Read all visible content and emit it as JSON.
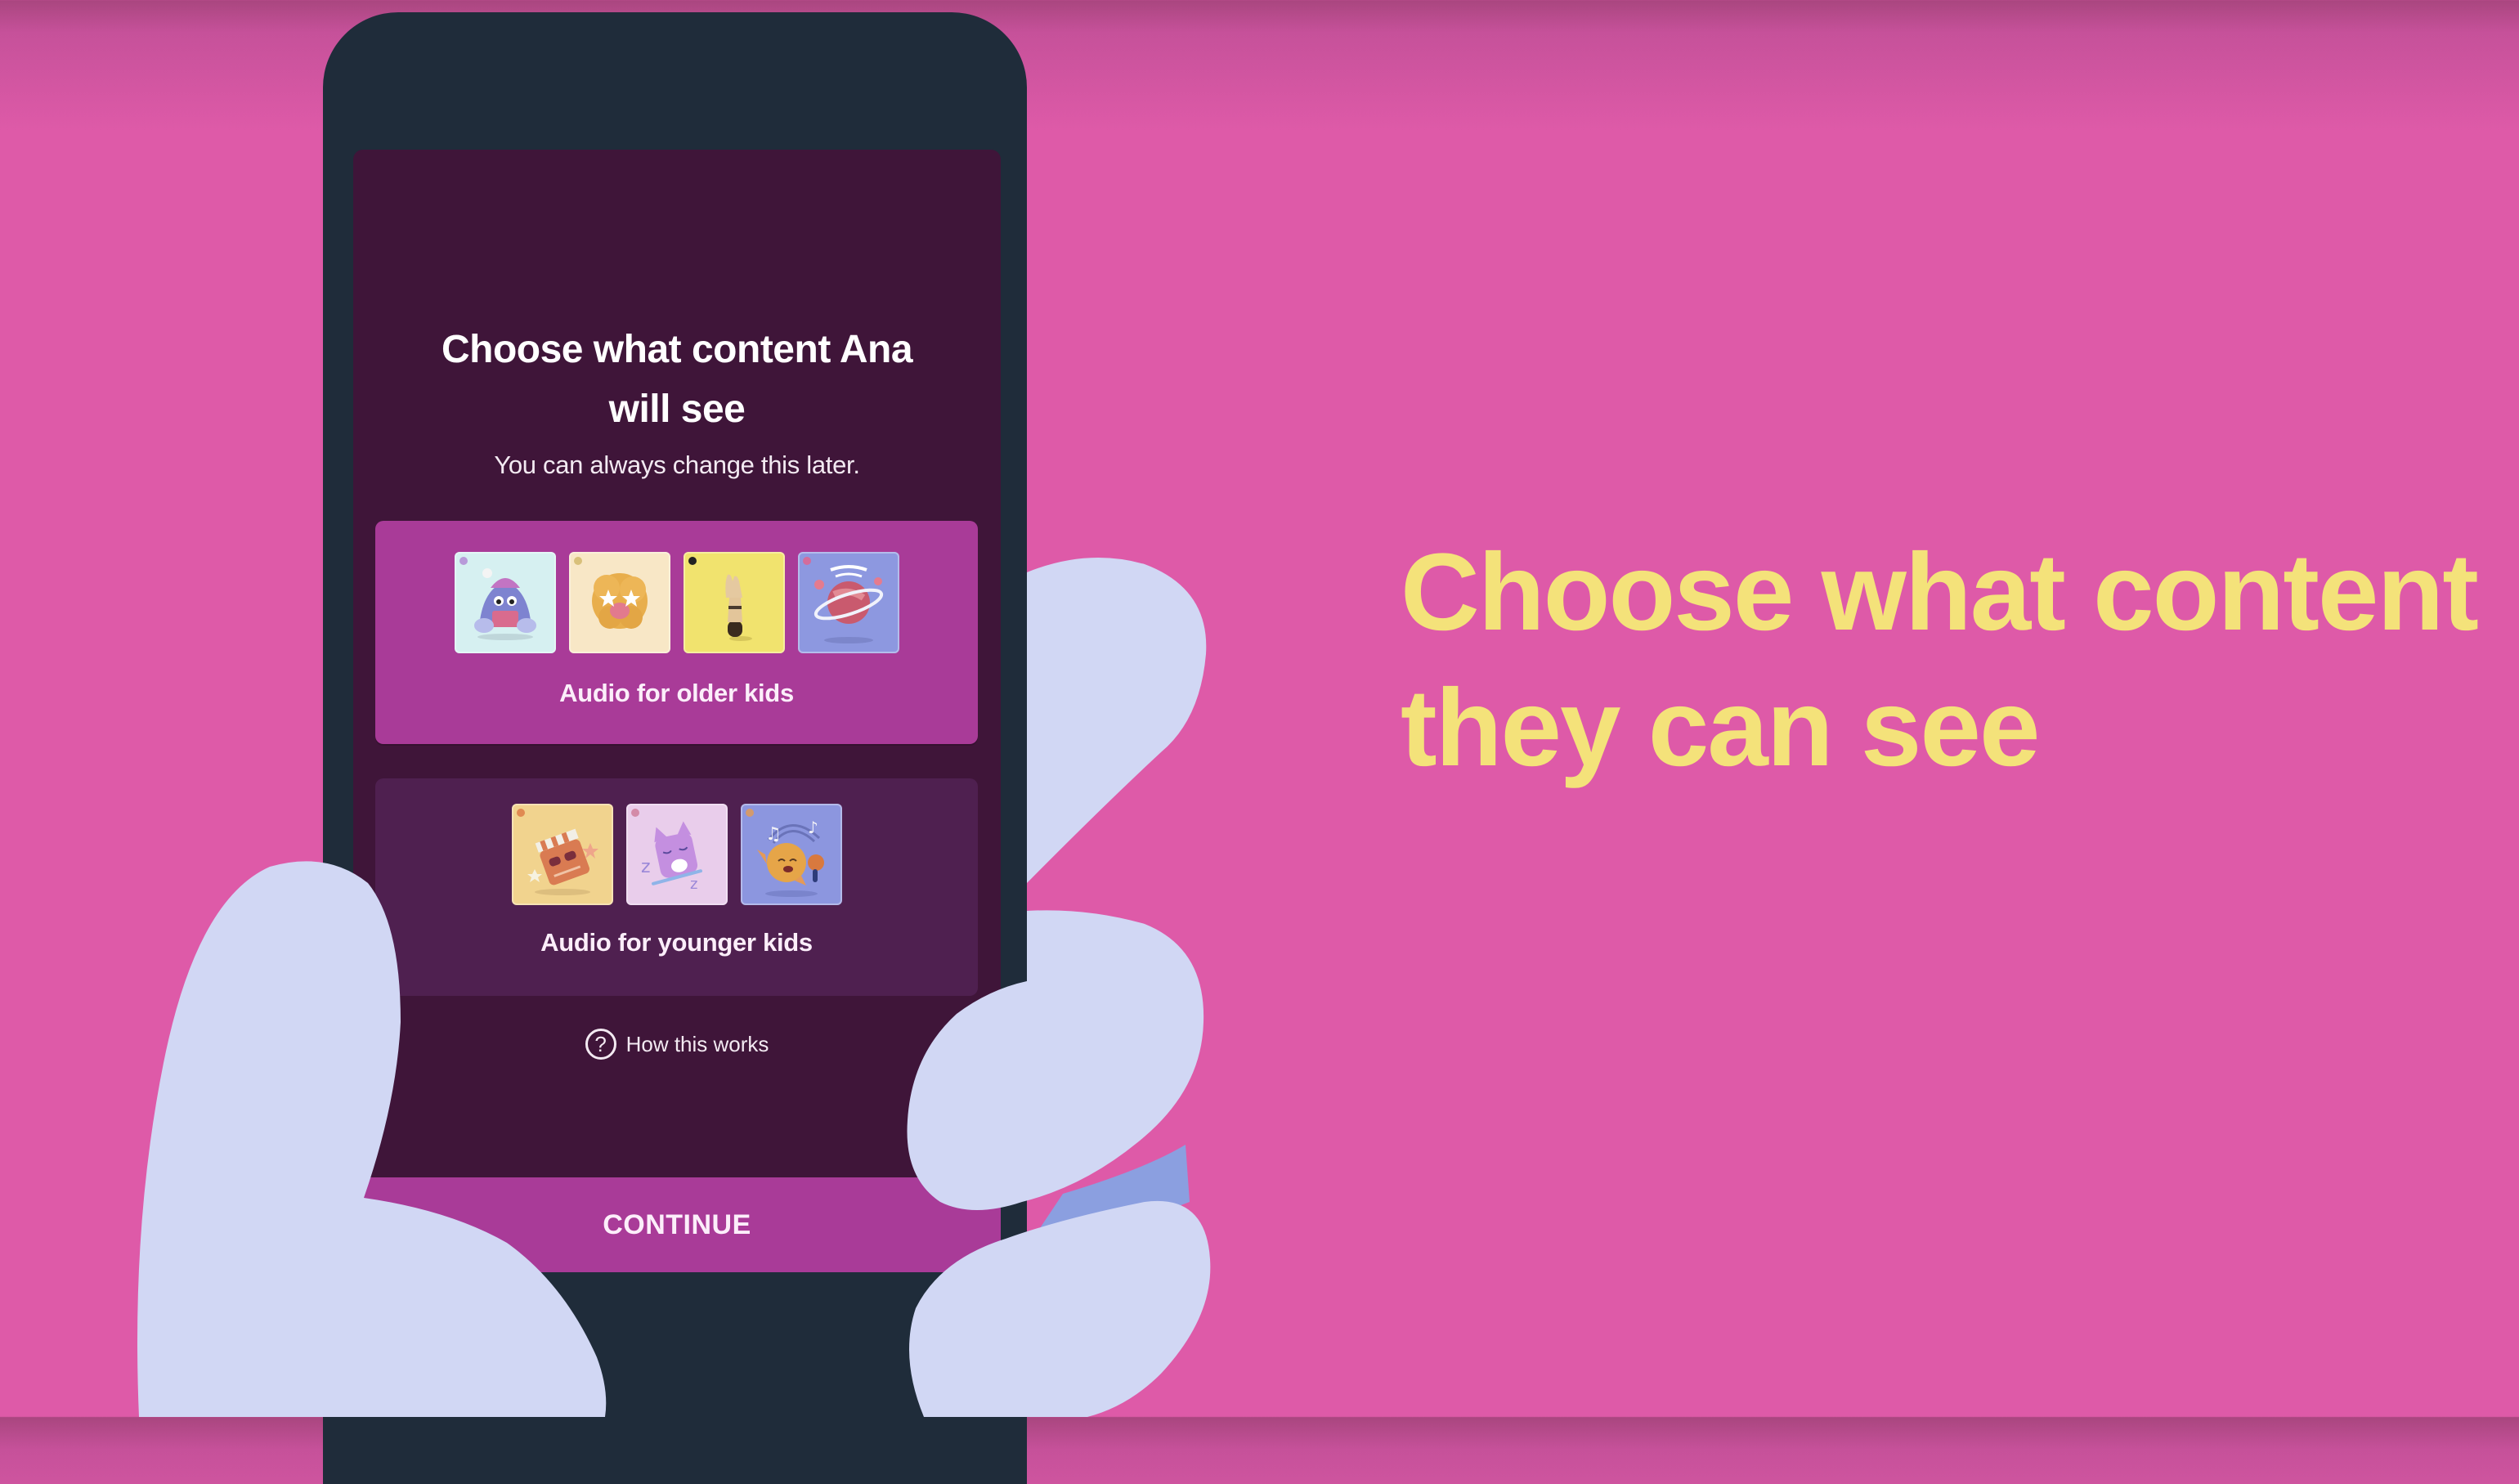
{
  "colors": {
    "background": "#DE5AA8",
    "phone_body": "#1F2C3A",
    "screen_bg": "#3F1539",
    "selected_card": "#A93B98",
    "unselected_card": "#4F2050",
    "accent_button": "#A93B98",
    "headline": "#F4E27A",
    "hand": "#D1D7F4"
  },
  "phone_screen": {
    "title_line1": "Choose what content Ana",
    "title_line2": "will see",
    "subtitle": "You can always change this later.",
    "options": [
      {
        "label": "Audio for older kids",
        "selected": true,
        "thumbnails": [
          {
            "icon": "book-reading-creature-icon",
            "bg": "#D6F0F1"
          },
          {
            "icon": "star-eyed-fluffy-creature-icon",
            "bg": "#F8E7C6"
          },
          {
            "icon": "raised-hand-icon",
            "bg": "#F1E36E"
          },
          {
            "icon": "ringed-planet-icon",
            "bg": "#8D98E0"
          }
        ]
      },
      {
        "label": "Audio for younger kids",
        "selected": false,
        "thumbnails": [
          {
            "icon": "clapperboard-sunglasses-icon",
            "bg": "#F1D38E"
          },
          {
            "icon": "sleeping-cat-icon",
            "bg": "#E9CDEB"
          },
          {
            "icon": "singing-sun-microphone-icon",
            "bg": "#8C96DF"
          }
        ]
      }
    ],
    "help_link": "How this works",
    "continue_label": "CONTINUE"
  },
  "headline": {
    "line1": "Choose what content",
    "line2": "they can see"
  }
}
